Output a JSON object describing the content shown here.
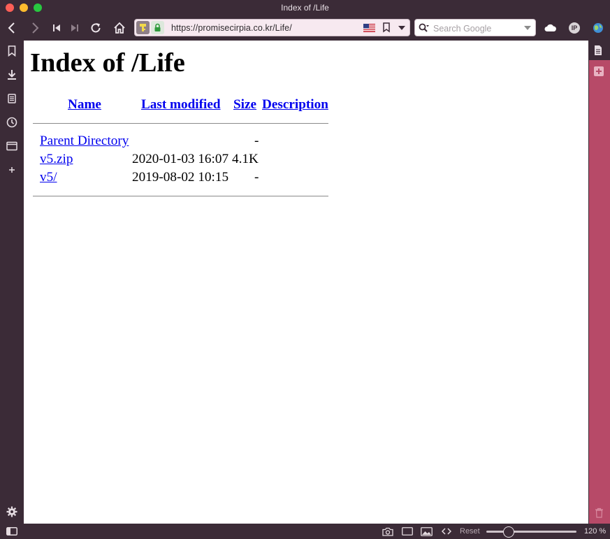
{
  "window": {
    "title": "Index of /Life"
  },
  "toolbar": {
    "url": "https://promisecirpia.co.kr/Life/",
    "search_placeholder": "Search Google",
    "ip_badge": "IP"
  },
  "page": {
    "heading": "Index of /Life",
    "columns": {
      "name": "Name",
      "last_modified": "Last modified",
      "size": "Size",
      "description": "Description"
    },
    "rows": [
      {
        "name": "Parent Directory",
        "modified": "",
        "size": "-",
        "description": ""
      },
      {
        "name": "v5.zip",
        "modified": "2020-01-03 16:07",
        "size": "4.1K",
        "description": ""
      },
      {
        "name": "v5/",
        "modified": "2019-08-02 10:15",
        "size": "-",
        "description": ""
      }
    ]
  },
  "statusbar": {
    "reset_label": "Reset",
    "zoom": "120 %",
    "zoom_percent": 120
  },
  "colors": {
    "chrome": "#3b2b37",
    "panel_accent": "#b74a68",
    "link": "#0000ee"
  }
}
